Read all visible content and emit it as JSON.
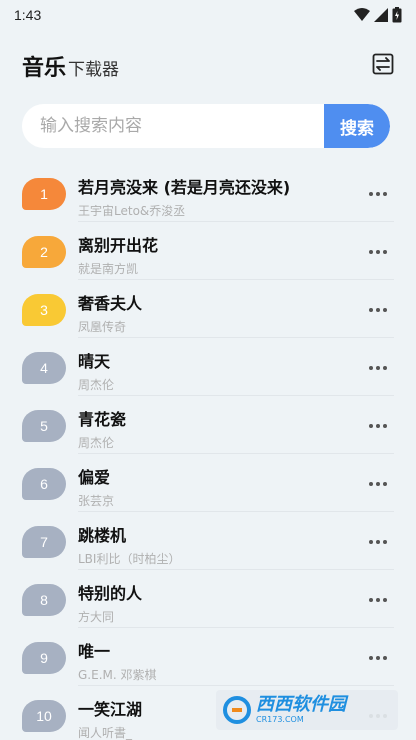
{
  "status_bar": {
    "time": "1:43"
  },
  "header": {
    "title": "音乐",
    "subtitle": "下载器"
  },
  "search": {
    "placeholder": "输入搜索内容",
    "button_label": "搜索"
  },
  "colors": {
    "rank1": "#f5883a",
    "rank2": "#f7a83a",
    "rank3": "#f9c934",
    "rank_other": "#a7b1c2",
    "accent": "#4f8ef0"
  },
  "songs": [
    {
      "rank": "1",
      "title": "若月亮没来 (若是月亮还没来)",
      "artist": "王宇宙Leto&乔浚丞"
    },
    {
      "rank": "2",
      "title": "离别开出花",
      "artist": "就是南方凯"
    },
    {
      "rank": "3",
      "title": "奢香夫人",
      "artist": "凤凰传奇"
    },
    {
      "rank": "4",
      "title": "晴天",
      "artist": "周杰伦"
    },
    {
      "rank": "5",
      "title": "青花瓷",
      "artist": "周杰伦"
    },
    {
      "rank": "6",
      "title": "偏爱",
      "artist": "张芸京"
    },
    {
      "rank": "7",
      "title": "跳楼机",
      "artist": "LBI利比（时柏尘）"
    },
    {
      "rank": "8",
      "title": "特别的人",
      "artist": "方大同"
    },
    {
      "rank": "9",
      "title": "唯一",
      "artist": "G.E.M. 邓紫棋"
    },
    {
      "rank": "10",
      "title": "一笑江湖",
      "artist": "闻人听書_"
    }
  ],
  "watermark": {
    "main": "西西软件园",
    "sub": "CR173.COM"
  }
}
